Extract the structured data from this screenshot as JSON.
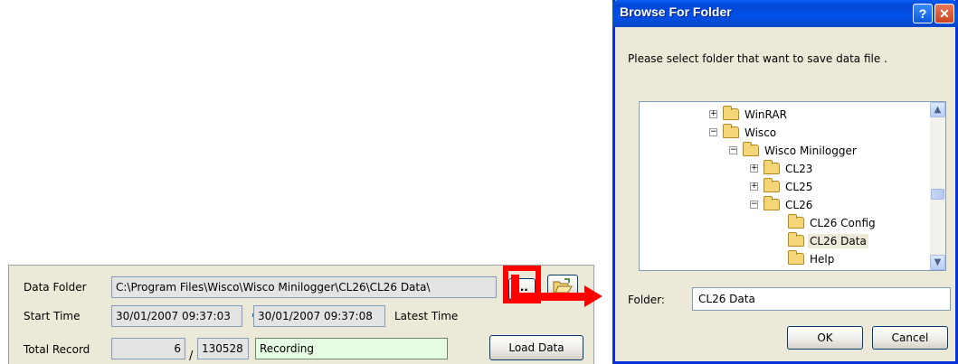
{
  "panel": {
    "data_folder_label": "Data Folder",
    "data_folder_value": "C:\\Program Files\\Wisco\\Wisco Minilogger\\CL26\\CL26 Data\\",
    "browse_label": "...",
    "start_time_label": "Start Time",
    "start_time_value": "30/01/2007  09:37:03",
    "latest_time_value": "30/01/2007  09:37:08",
    "latest_time_label": "Latest Time",
    "total_record_label": "Total Record",
    "record_count": "6",
    "record_separator": "/",
    "record_total": "130528",
    "status": "Recording",
    "load_label": "Load Data"
  },
  "dialog": {
    "title": "Browse For Folder",
    "help_label": "?",
    "close_label": "✕",
    "prompt": "Please select folder that want to save data file .",
    "tree": [
      {
        "label": "WinRAR",
        "expander": "+"
      },
      {
        "label": "Wisco",
        "expander": "−"
      },
      {
        "label": "Wisco Minilogger",
        "expander": "−"
      },
      {
        "label": "CL23",
        "expander": "+"
      },
      {
        "label": "CL25",
        "expander": "+"
      },
      {
        "label": "CL26",
        "expander": "−"
      },
      {
        "label": "CL26 Config",
        "expander": ""
      },
      {
        "label": "CL26 Data",
        "expander": "",
        "selected": true
      },
      {
        "label": "Help",
        "expander": ""
      }
    ],
    "folder_label": "Folder:",
    "folder_value": "CL26 Data",
    "ok_label": "OK",
    "cancel_label": "Cancel"
  },
  "colors": {
    "highlight": "#ff0000",
    "title_bar": "#0150e8",
    "status_bg": "#e6fbe3"
  },
  "icons": {
    "open_folder": "open-folder-icon",
    "tree_folder": "folder-icon"
  }
}
